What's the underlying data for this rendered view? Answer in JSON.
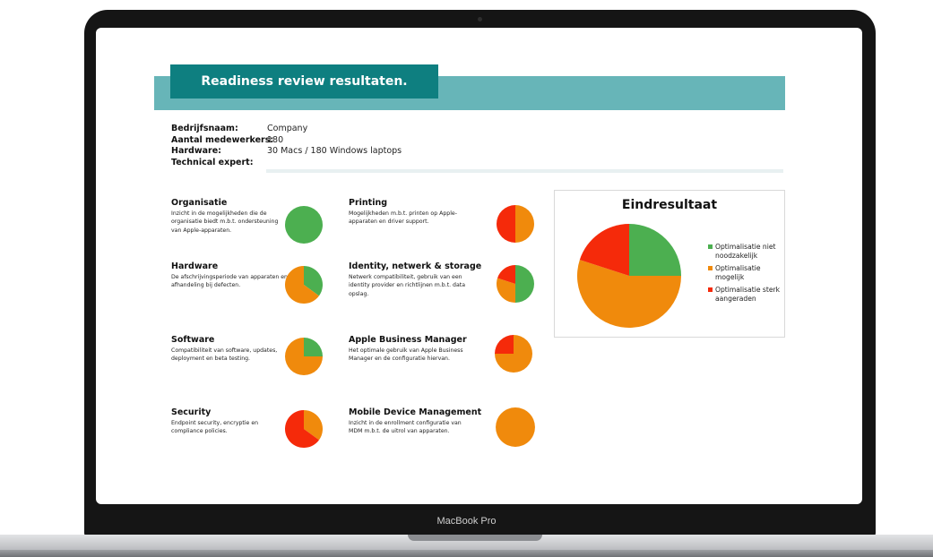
{
  "device": {
    "model_label": "MacBook Pro"
  },
  "report": {
    "title": "Readiness review resultaten.",
    "info": [
      {
        "label": "Bedrijfsnaam:",
        "value": "Company"
      },
      {
        "label": "Aantal medewerkers:",
        "value": "180"
      },
      {
        "label": "Hardware:",
        "value": "30 Macs / 180 Windows laptops"
      },
      {
        "label": "Technical expert:",
        "value": ""
      }
    ],
    "categories": [
      {
        "title": "Organisatie",
        "desc": "Inzicht in de mogelijkheden die de organisatie biedt m.b.t. ondersteuning van Apple-apparaten.",
        "pie": {
          "green": 1.0,
          "orange": 0.0,
          "red": 0.0
        }
      },
      {
        "title": "Printing",
        "desc": "Mogelijkheden m.b.t. printen op Apple-apparaten en driver support.",
        "pie": {
          "green": 0.0,
          "orange": 0.5,
          "red": 0.5
        }
      },
      {
        "title": "Hardware",
        "desc": "De afschrijvingsperiode van apparaten en afhandeling bij defecten.",
        "pie": {
          "green": 0.35,
          "orange": 0.65,
          "red": 0.0
        }
      },
      {
        "title": "Identity, netwerk & storage",
        "desc": "Netwerk compatibiliteit, gebruik van een identity provider en richtlijnen m.b.t. data opslag.",
        "pie": {
          "green": 0.5,
          "orange": 0.3,
          "red": 0.2
        }
      },
      {
        "title": "Software",
        "desc": "Compatibiliteit van software, updates, deployment en beta testing.",
        "pie": {
          "green": 0.25,
          "orange": 0.75,
          "red": 0.0
        }
      },
      {
        "title": "Apple Business Manager",
        "desc": "Het optimale gebruik van Apple Business Manager en de configuratie hiervan.",
        "pie": {
          "green": 0.0,
          "orange": 0.75,
          "red": 0.25
        }
      },
      {
        "title": "Security",
        "desc": "Endpoint security, encryptie en compliance policies.",
        "pie": {
          "green": 0.0,
          "orange": 0.35,
          "red": 0.65
        }
      },
      {
        "title": "Mobile Device Management",
        "desc": "Inzicht in de enrollment configuratie van MDM m.b.t. de uitrol van apparaten.",
        "pie": {
          "green": 0.0,
          "orange": 1.0,
          "red": 0.0
        }
      }
    ],
    "result": {
      "title": "Eindresultaat",
      "legend": [
        {
          "label": "Optimalisatie niet noodzakelijk",
          "color": "#4caf50"
        },
        {
          "label": "Optimalisatie mogelijk",
          "color": "#f08a0c"
        },
        {
          "label": "Optimalisatie sterk aangeraden",
          "color": "#f52a0a"
        }
      ]
    }
  },
  "chart_data": {
    "type": "pie",
    "title": "Eindresultaat",
    "categories": [
      "Optimalisatie niet noodzakelijk",
      "Optimalisatie mogelijk",
      "Optimalisatie sterk aangeraden"
    ],
    "values": [
      25,
      55,
      20
    ],
    "colors": [
      "#4caf50",
      "#f08a0c",
      "#f52a0a"
    ],
    "legend": "right"
  }
}
